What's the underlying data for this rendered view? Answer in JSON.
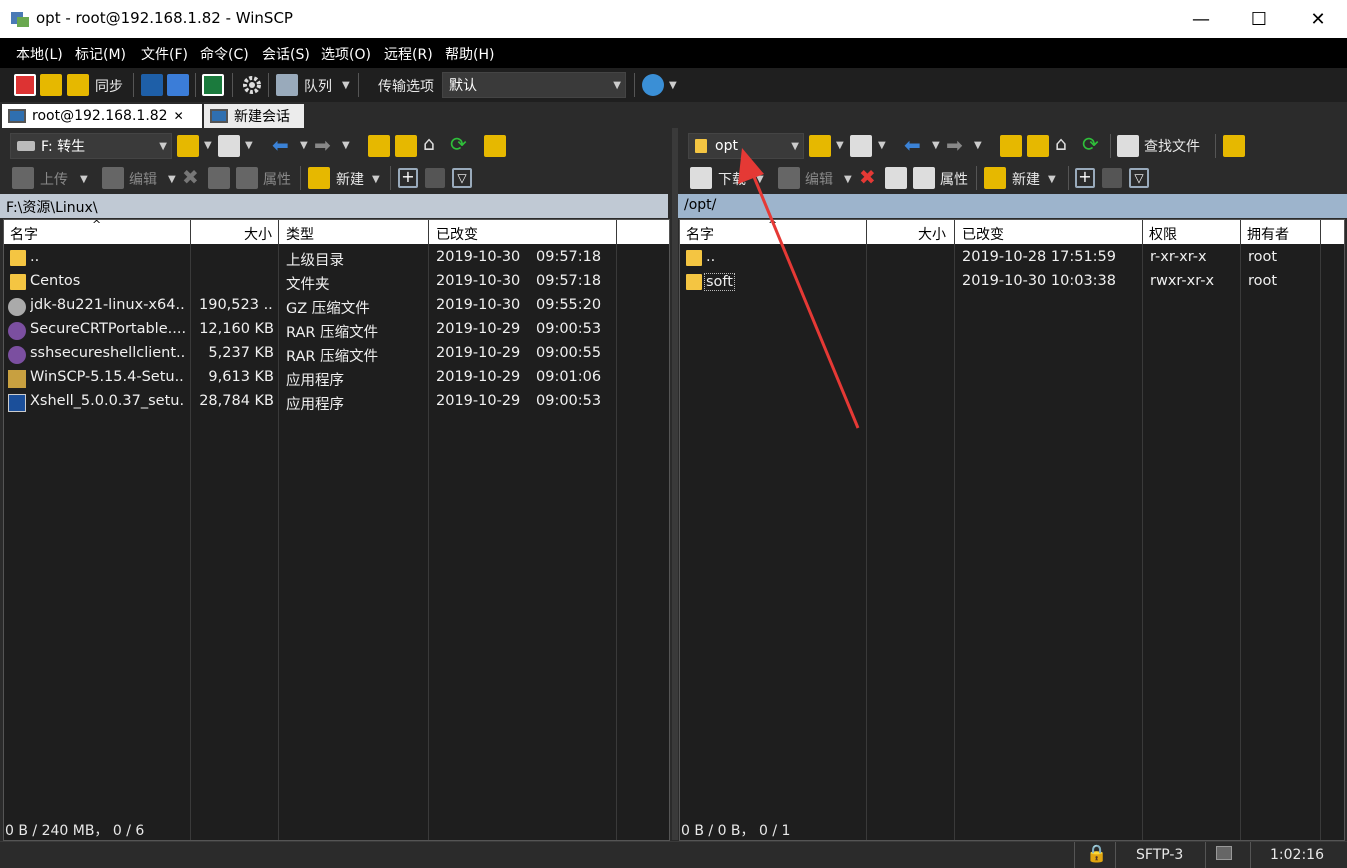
{
  "window": {
    "title": "opt - root@192.168.1.82 - WinSCP",
    "minimize": "—",
    "maximize": "☐",
    "close": "✕"
  },
  "menu": [
    "本地(L)",
    "标记(M)",
    "文件(F)",
    "命令(C)",
    "会话(S)",
    "选项(O)",
    "远程(R)",
    "帮助(H)"
  ],
  "toolbar": {
    "sync_label": "同步",
    "queue_label": "队列",
    "transfer_label": "传输选项",
    "transfer_value": "默认"
  },
  "tabs": {
    "session": "root@192.168.1.82",
    "new_session": "新建会话"
  },
  "left": {
    "drive": "F: 转生",
    "upload": "上传",
    "edit": "编辑",
    "props": "属性",
    "new": "新建",
    "path": "F:\\资源\\Linux\\",
    "headers": {
      "name": "名字",
      "size": "大小",
      "type": "类型",
      "changed": "已改变"
    },
    "rows": [
      {
        "name": "..",
        "size": "",
        "type": "上级目录",
        "date": "2019-10-30",
        "time": "09:57:18",
        "icon": "parent-folder-icon"
      },
      {
        "name": "Centos",
        "size": "",
        "type": "文件夹",
        "date": "2019-10-30",
        "time": "09:57:18",
        "icon": "folder-icon"
      },
      {
        "name": "jdk-8u221-linux-x64...",
        "size": "190,523 ...",
        "type": "GZ 压缩文件",
        "date": "2019-10-30",
        "time": "09:55:20",
        "icon": "gz-archive-icon"
      },
      {
        "name": "SecureCRTPortable....",
        "size": "12,160 KB",
        "type": "RAR 压缩文件",
        "date": "2019-10-29",
        "time": "09:00:53",
        "icon": "rar-archive-icon"
      },
      {
        "name": "sshsecureshellclient...",
        "size": "5,237 KB",
        "type": "RAR 压缩文件",
        "date": "2019-10-29",
        "time": "09:00:55",
        "icon": "rar-archive-icon"
      },
      {
        "name": "WinSCP-5.15.4-Setu...",
        "size": "9,613 KB",
        "type": "应用程序",
        "date": "2019-10-29",
        "time": "09:01:06",
        "icon": "installer-icon"
      },
      {
        "name": "Xshell_5.0.0.37_setu...",
        "size": "28,784 KB",
        "type": "应用程序",
        "date": "2019-10-29",
        "time": "09:00:53",
        "icon": "xshell-installer-icon"
      }
    ],
    "status": "0 B / 240 MB， 0 / 6"
  },
  "right": {
    "dir": "opt",
    "find": "查找文件",
    "download": "下载",
    "edit": "编辑",
    "props": "属性",
    "new": "新建",
    "path": "/opt/",
    "headers": {
      "name": "名字",
      "size": "大小",
      "changed": "已改变",
      "perms": "权限",
      "owner": "拥有者"
    },
    "rows": [
      {
        "name": "..",
        "size": "",
        "changed": "2019-10-28 17:51:59",
        "perms": "r-xr-xr-x",
        "owner": "root",
        "icon": "parent-folder-icon"
      },
      {
        "name": "soft",
        "size": "",
        "changed": "2019-10-30 10:03:38",
        "perms": "rwxr-xr-x",
        "owner": "root",
        "icon": "folder-icon"
      }
    ],
    "status": "0 B / 0 B， 0 / 1"
  },
  "bottom": {
    "protocol": "SFTP-3",
    "time": "1:02:16"
  },
  "colors": {
    "accent_path_left": "#c0c9d4",
    "accent_path_right": "#9db4cc",
    "annotation_arrow": "#e53935"
  }
}
